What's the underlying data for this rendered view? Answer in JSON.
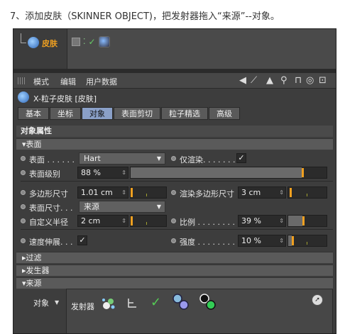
{
  "caption": "7、添加皮肤（SKINNER OBJECT)，把发射器拖入“来源”--对象。",
  "object_manager": {
    "object_name": "皮肤"
  },
  "menu": {
    "items": [
      "模式",
      "编辑",
      "用户数据"
    ]
  },
  "object_title": "X-粒子皮肤 [皮肤]",
  "tabs": [
    "基本",
    "坐标",
    "对象",
    "表面剪切",
    "粒子精选",
    "高级"
  ],
  "active_tab": "对象",
  "section_title": "对象属性",
  "surface_section": "▾表面",
  "fields": {
    "surface_label": "表面 . . . . . .",
    "surface_value": "Hart",
    "render_only_label": "仅渲染. . . . . . . .",
    "render_only_checked": true,
    "surface_level_label": "表面级别",
    "surface_level_value": "88 %",
    "surface_level_fraction": 0.88,
    "polysize_label": "多边形尺寸",
    "polysize_value": "1.01 cm",
    "render_polysize_label": "渲染多边形尺寸",
    "render_polysize_value": "3 cm",
    "surfsize_label": "表面尺寸. . .",
    "surfsize_value": "来源",
    "custom_radius_label": "自定义半径",
    "custom_radius_value": "2 cm",
    "scale_label": "比例 . . . . . . . . .",
    "scale_value": "39 %",
    "scale_fraction": 0.39,
    "speed_stretch_label": "速度伸展. . .",
    "speed_stretch_checked": true,
    "strength_label": "强度 . . . . . . . . .",
    "strength_value": "10 %",
    "strength_fraction": 0.1
  },
  "collapsed_sections": [
    "▸过滤",
    "▸发生器"
  ],
  "source_section": "▾来源",
  "source": {
    "object_label": "对象",
    "emitter_label": "发射器",
    "check_glyph": "✓"
  },
  "colors": {
    "accent": "#f0a020",
    "active_tab": "#8aa0c8",
    "panel": "#3d3d3d"
  }
}
